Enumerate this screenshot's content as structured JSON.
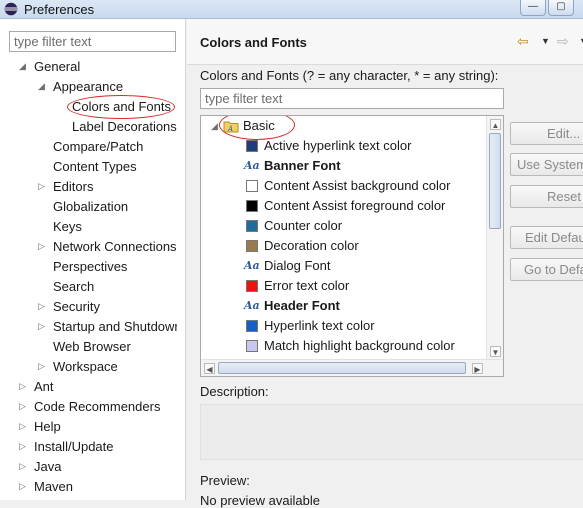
{
  "window": {
    "title": "Preferences",
    "minimize_glyph": "—",
    "maximize_glyph": "▢"
  },
  "left": {
    "filter_placeholder": "type filter text",
    "tree": [
      {
        "label": "General",
        "expanded": true
      },
      {
        "label": "Appearance",
        "expanded": true
      },
      {
        "label": "Colors and Fonts",
        "selected": true
      },
      {
        "label": "Label Decorations"
      },
      {
        "label": "Compare/Patch"
      },
      {
        "label": "Content Types"
      },
      {
        "label": "Editors",
        "expanded": false
      },
      {
        "label": "Globalization"
      },
      {
        "label": "Keys"
      },
      {
        "label": "Network Connections",
        "expanded": false
      },
      {
        "label": "Perspectives"
      },
      {
        "label": "Search"
      },
      {
        "label": "Security",
        "expanded": false
      },
      {
        "label": "Startup and Shutdown",
        "expanded": false
      },
      {
        "label": "Web Browser"
      },
      {
        "label": "Workspace",
        "expanded": false
      },
      {
        "label": "Ant",
        "expanded": false
      },
      {
        "label": "Code Recommenders",
        "expanded": false
      },
      {
        "label": "Help",
        "expanded": false
      },
      {
        "label": "Install/Update",
        "expanded": false
      },
      {
        "label": "Java",
        "expanded": false
      },
      {
        "label": "Maven",
        "expanded": false
      }
    ]
  },
  "main": {
    "title": "Colors and Fonts",
    "intro": "Colors and Fonts (? = any character, * = any string):",
    "filter_placeholder": "type filter text",
    "category": "Basic",
    "items": [
      {
        "label": "Active hyperlink text color",
        "kind": "color",
        "color": "#1f3f7a"
      },
      {
        "label": "Banner Font",
        "kind": "font",
        "bold": true
      },
      {
        "label": "Content Assist background color",
        "kind": "color",
        "color": "#ffffff"
      },
      {
        "label": "Content Assist foreground color",
        "kind": "color",
        "color": "#000000"
      },
      {
        "label": "Counter color",
        "kind": "color",
        "color": "#1e6d9c"
      },
      {
        "label": "Decoration color",
        "kind": "color",
        "color": "#9a7b4f"
      },
      {
        "label": "Dialog Font",
        "kind": "font",
        "bold": false
      },
      {
        "label": "Error text color",
        "kind": "color",
        "color": "#e8140f"
      },
      {
        "label": "Header Font",
        "kind": "font",
        "bold": true
      },
      {
        "label": "Hyperlink text color",
        "kind": "color",
        "color": "#1361c8"
      },
      {
        "label": "Match highlight background color",
        "kind": "color",
        "color": "#c9c6f0"
      }
    ],
    "buttons": {
      "edit": "Edit...",
      "use_system": "Use System Font",
      "reset": "Reset",
      "edit_default": "Edit Default...",
      "go_to_default": "Go to Default"
    },
    "description_label": "Description:",
    "preview_label": "Preview:",
    "preview_text": "No preview available"
  }
}
